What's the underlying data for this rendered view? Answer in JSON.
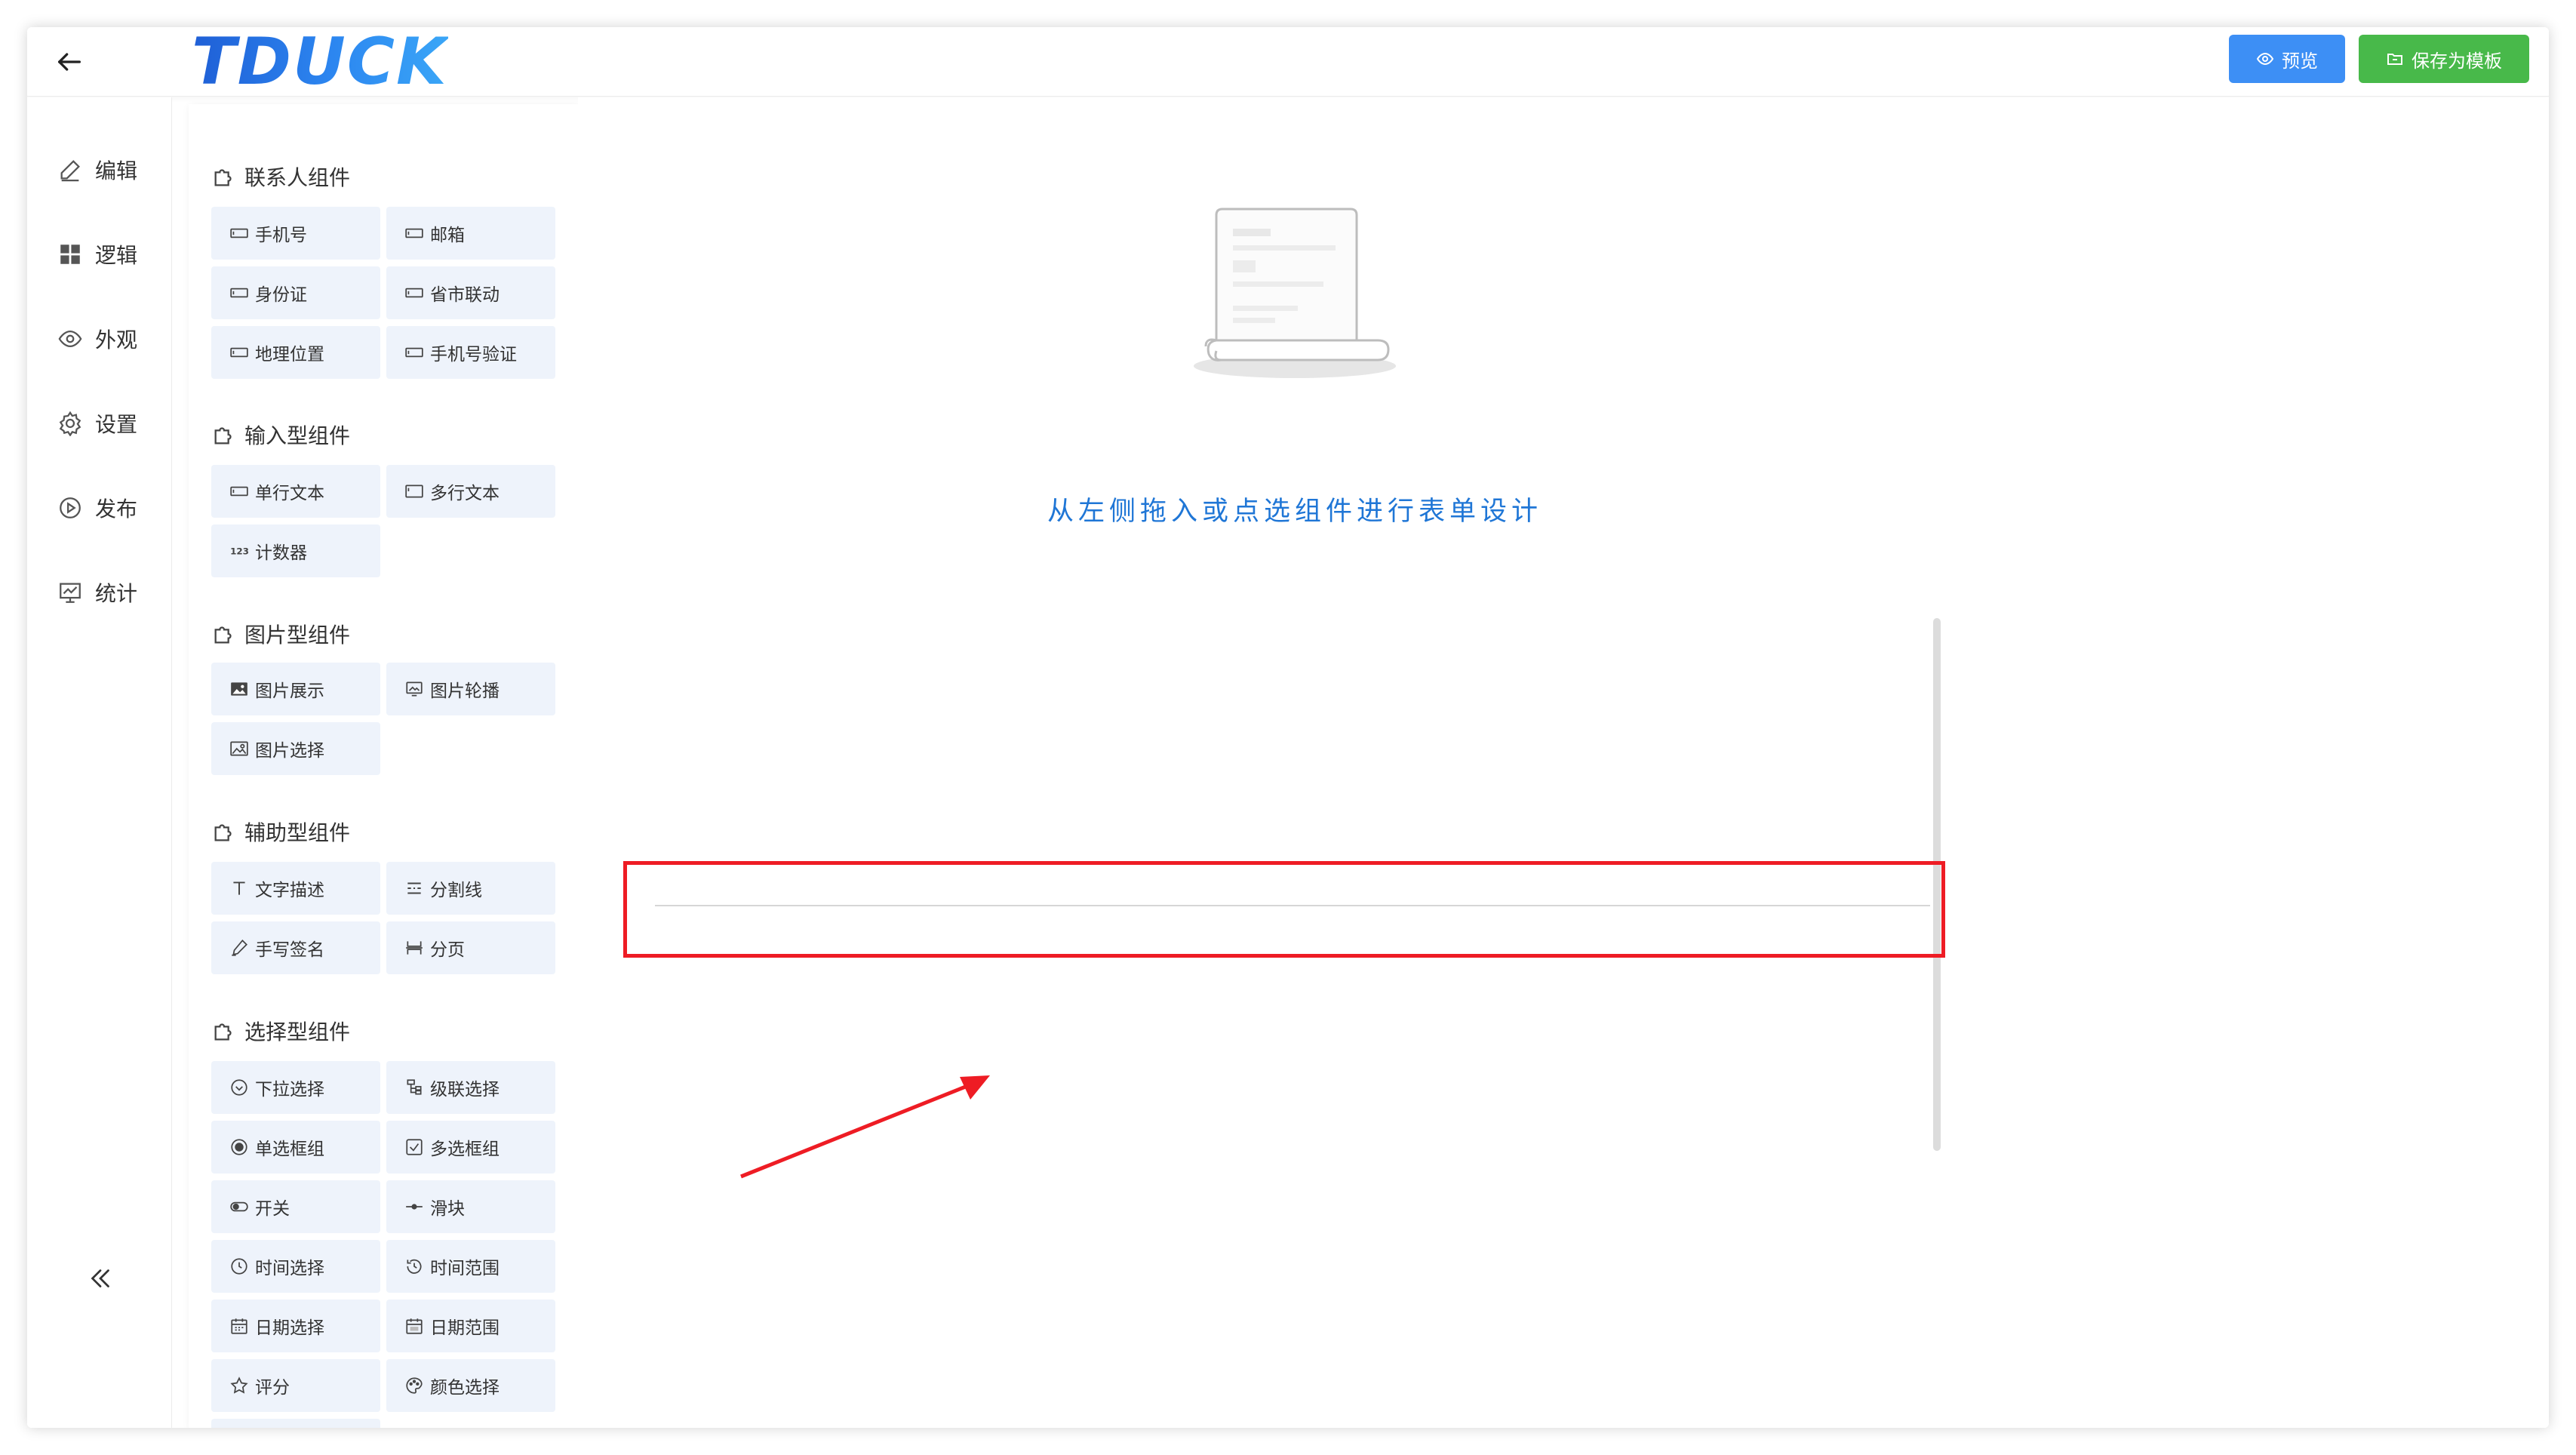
{
  "header": {
    "logo_text": "TDUCK",
    "preview_label": "预览",
    "save_template_label": "保存为模板"
  },
  "nav": {
    "items": [
      {
        "label": "编辑",
        "icon": "edit-icon"
      },
      {
        "label": "逻辑",
        "icon": "grid-icon"
      },
      {
        "label": "外观",
        "icon": "eye-icon"
      },
      {
        "label": "设置",
        "icon": "gear-icon"
      },
      {
        "label": "发布",
        "icon": "play-circle-icon"
      },
      {
        "label": "统计",
        "icon": "chart-board-icon"
      }
    ],
    "collapse_icon": "double-chevron-left-icon"
  },
  "panel": {
    "groups": [
      {
        "title": "联系人组件",
        "items": [
          "手机号",
          "邮箱",
          "身份证",
          "省市联动",
          "地理位置",
          "手机号验证"
        ]
      },
      {
        "title": "输入型组件",
        "items": [
          "单行文本",
          "多行文本",
          "计数器"
        ]
      },
      {
        "title": "图片型组件",
        "items": [
          "图片展示",
          "图片轮播",
          "图片选择"
        ]
      },
      {
        "title": "辅助型组件",
        "items": [
          "文字描述",
          "分割线",
          "手写签名",
          "分页"
        ]
      },
      {
        "title": "选择型组件",
        "items": [
          "下拉选择",
          "级联选择",
          "单选框组",
          "多选框组",
          "开关",
          "滑块",
          "时间选择",
          "时间范围",
          "日期选择",
          "日期范围",
          "评分",
          "颜色选择"
        ]
      }
    ]
  },
  "canvas": {
    "empty_text": "从左侧拖入或点选组件进行表单设计"
  },
  "colors": {
    "primary": "#3d8ff5",
    "success": "#48b94a",
    "annotation_red": "#ee1c24",
    "hint_blue": "#1f76d6",
    "component_bg": "#eef3fb"
  }
}
